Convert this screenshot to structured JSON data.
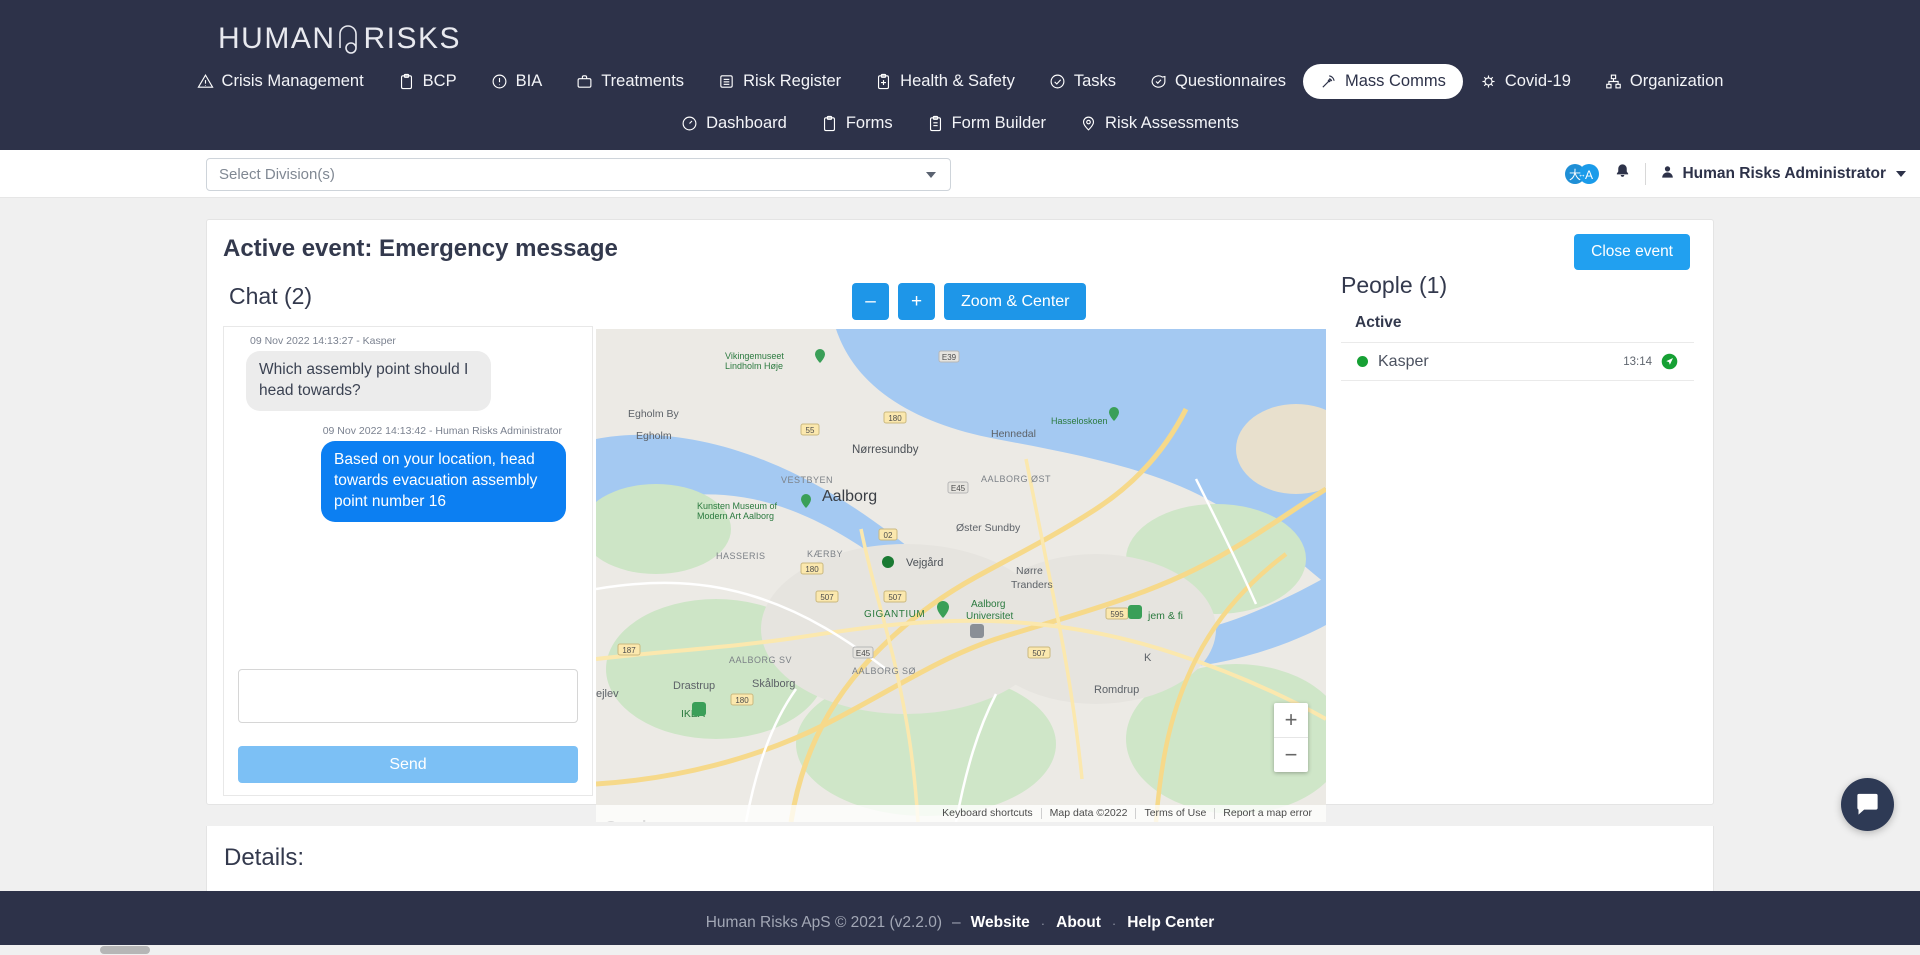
{
  "brand": {
    "logo_text_1": "HUMAN",
    "logo_text_2": "RISKS"
  },
  "nav": {
    "row1": [
      {
        "label": "Crisis Management",
        "icon": "warning-triangle-icon",
        "active": false
      },
      {
        "label": "BCP",
        "icon": "clipboard-icon",
        "active": false
      },
      {
        "label": "BIA",
        "icon": "info-circle-icon",
        "active": false
      },
      {
        "label": "Treatments",
        "icon": "toolbox-icon",
        "active": false
      },
      {
        "label": "Risk Register",
        "icon": "list-icon",
        "active": false
      },
      {
        "label": "Health & Safety",
        "icon": "medical-clipboard-icon",
        "active": false
      },
      {
        "label": "Tasks",
        "icon": "check-circle-icon",
        "active": false
      },
      {
        "label": "Questionnaires",
        "icon": "chat-check-icon",
        "active": false
      },
      {
        "label": "Mass Comms",
        "icon": "broadcast-icon",
        "active": true
      },
      {
        "label": "Covid-19",
        "icon": "virus-icon",
        "active": false
      },
      {
        "label": "Organization",
        "icon": "org-chart-icon",
        "active": false
      }
    ],
    "row2": [
      {
        "label": "Dashboard",
        "icon": "speedometer-icon",
        "active": false
      },
      {
        "label": "Forms",
        "icon": "clipboard-icon",
        "active": false
      },
      {
        "label": "Form Builder",
        "icon": "clipboard-icon",
        "active": false
      },
      {
        "label": "Risk Assessments",
        "icon": "location-pin-icon",
        "active": false
      }
    ]
  },
  "subheader": {
    "division_placeholder": "Select Division(s)",
    "translate_icon": "translate-icon",
    "notification_icon": "bell-icon",
    "user_icon": "user-icon",
    "user_name": "Human Risks Administrator"
  },
  "main": {
    "event_title": "Active event: Emergency message",
    "close_event_label": "Close event",
    "details_title": "Details:"
  },
  "chat": {
    "title": "Chat (2)",
    "messages": [
      {
        "meta": "09 Nov 2022 14:13:27 - Kasper",
        "text": "Which assembly point should I head towards?",
        "direction": "incoming"
      },
      {
        "meta": "09 Nov 2022 14:13:42 - Human Risks Administrator",
        "text": "Based on your location, head towards evacuation assembly point number 16",
        "direction": "outgoing"
      }
    ],
    "input_value": "",
    "input_placeholder": "",
    "send_label": "Send"
  },
  "map": {
    "zoom_out_label": "–",
    "zoom_in_label": "+",
    "zoom_center_label": "Zoom & Center",
    "provider_logo": "Google",
    "zoom_in_control": "+",
    "zoom_out_control": "−",
    "attribution": [
      "Keyboard shortcuts",
      "Map data ©2022",
      "Terms of Use",
      "Report a map error"
    ],
    "labels": {
      "city": "Aalborg",
      "places": [
        "Vikingemuseet Lindholm Høje",
        "Nørresundby",
        "Hennedal",
        "Hasseloskoen",
        "Egholm By",
        "Egholm",
        "VESTBYEN",
        "AALBORG ØST",
        "Øster Sundby",
        "Kunsten Museum of Modern Art Aalborg",
        "HASSERIS",
        "KÆRBY",
        "Vejgård",
        "Nørre Tranders",
        "Aalborg Universitet",
        "GIGANTIUM",
        "AALBORG SV",
        "AALBORG SØ",
        "Skålborg",
        "Drastrup",
        "Romdrup",
        "IKEA",
        "jem & fix",
        "ejlev"
      ],
      "roads": [
        "E39",
        "E45",
        "180",
        "55",
        "02",
        "507",
        "595",
        "187"
      ]
    }
  },
  "people": {
    "title": "People (1)",
    "section_label": "Active",
    "rows": [
      {
        "status": "online",
        "name": "Kasper",
        "time": "13:14",
        "action_icon": "location-arrow-icon"
      }
    ]
  },
  "footer": {
    "copyright": "Human Risks ApS © 2021 (v2.2.0)",
    "dash": "–",
    "links": [
      "Website",
      "About",
      "Help Center"
    ],
    "separator": "·"
  },
  "widgets": {
    "support_chat_icon": "intercom-chat-icon"
  },
  "colors": {
    "nav_bg": "#2d3249",
    "primary_blue": "#21a0f0",
    "bubble_blue": "#0c7ff2",
    "send_blue": "#7cc0f5",
    "online_green": "#16a034"
  }
}
